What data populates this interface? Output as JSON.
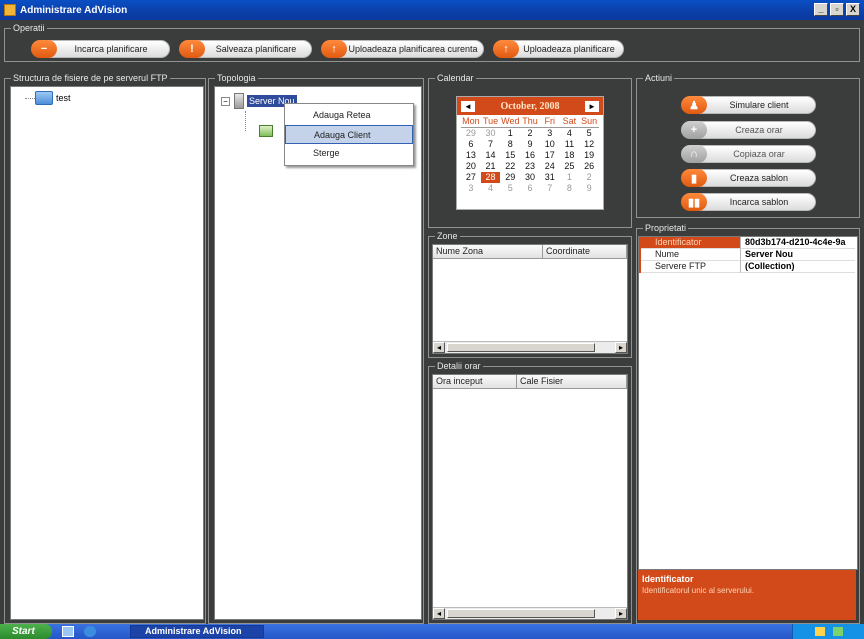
{
  "window": {
    "title": "Administrare AdVision",
    "buttons": [
      "_",
      "▫",
      "X"
    ]
  },
  "operatii": {
    "title": "Operatii",
    "buttons": [
      {
        "label": "Incarca planificare",
        "icon": "minus-icon"
      },
      {
        "label": "Salveaza planificare",
        "icon": "info-icon"
      },
      {
        "label": "Uploadeaza planificarea curenta",
        "icon": "upload-icon"
      },
      {
        "label": "Uploadeaza planificare",
        "icon": "upload-icon"
      }
    ]
  },
  "ftp": {
    "title": "Structura de fisiere de pe serverul FTP",
    "items": [
      {
        "label": "test",
        "icon": "folder-icon"
      }
    ]
  },
  "topologia": {
    "title": "Topologia",
    "server_label": "Server Nou",
    "context_menu": [
      "Adauga Retea",
      "Adauga Client",
      "Sterge"
    ]
  },
  "calendar": {
    "title": "Calendar",
    "month_title": "October, 2008",
    "days_of_week": [
      "Mon",
      "Tue",
      "Wed",
      "Thu",
      "Fri",
      "Sat",
      "Sun"
    ],
    "weeks": [
      [
        "29",
        "30",
        "1",
        "2",
        "3",
        "4",
        "5"
      ],
      [
        "6",
        "7",
        "8",
        "9",
        "10",
        "11",
        "12"
      ],
      [
        "13",
        "14",
        "15",
        "16",
        "17",
        "18",
        "19"
      ],
      [
        "20",
        "21",
        "22",
        "23",
        "24",
        "25",
        "26"
      ],
      [
        "27",
        "28",
        "29",
        "30",
        "31",
        "1",
        "2"
      ],
      [
        "3",
        "4",
        "5",
        "6",
        "7",
        "8",
        "9"
      ]
    ],
    "today": "28",
    "prev_symbol": "◄",
    "next_symbol": "►"
  },
  "zone": {
    "title": "Zone",
    "columns": [
      "Nume Zona",
      "Coordinate"
    ]
  },
  "detalii": {
    "title": "Detalii orar",
    "columns": [
      "Ora inceput",
      "Cale Fisier"
    ]
  },
  "actiuni": {
    "title": "Actiuni",
    "buttons": [
      {
        "label": "Simulare client",
        "active": true
      },
      {
        "label": "Creaza orar",
        "active": false
      },
      {
        "label": "Copiaza orar",
        "active": false
      },
      {
        "label": "Creaza sablon",
        "active": true
      },
      {
        "label": "Incarca sablon",
        "active": true
      }
    ]
  },
  "proprietati": {
    "title": "Proprietati",
    "rows": [
      {
        "key": "Identificator",
        "value": "80d3b174-d210-4c4e-9a"
      },
      {
        "key": "Nume",
        "value": "Server Nou"
      },
      {
        "key": "Servere FTP",
        "value": "(Collection)"
      }
    ],
    "desc_title": "Identificator",
    "desc_text": "Identificatorul unic al serverului."
  },
  "taskbar": {
    "start": "Start",
    "task": "Administrare AdVision"
  },
  "colors": {
    "accent": "#d24a1a",
    "background": "#3a3d3b",
    "title_bar": "#0a4fc4"
  }
}
